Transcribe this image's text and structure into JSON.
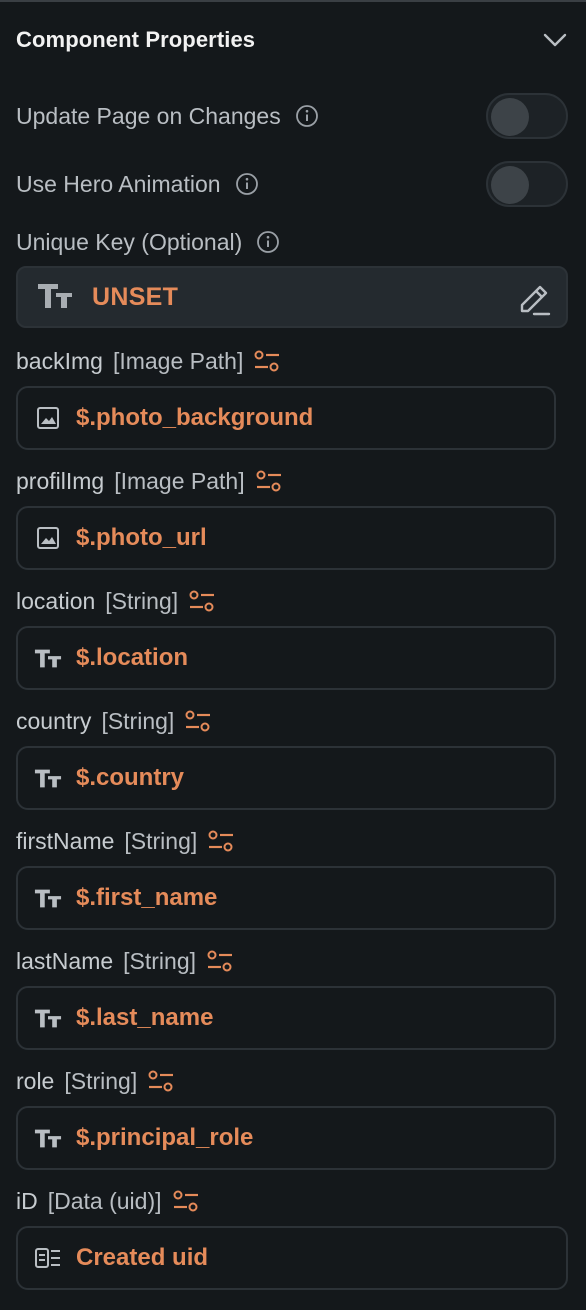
{
  "section_title": "Component Properties",
  "toggles": [
    {
      "label": "Update Page on Changes",
      "on": false
    },
    {
      "label": "Use Hero Animation",
      "on": false
    }
  ],
  "unique_key": {
    "label": "Unique Key (Optional)",
    "value": "UNSET"
  },
  "params": [
    {
      "name": "backImg",
      "type": "[Image Path]",
      "value": "$.photo_background",
      "icon": "image-icon"
    },
    {
      "name": "profilImg",
      "type": "[Image Path]",
      "value": "$.photo_url",
      "icon": "image-icon"
    },
    {
      "name": "location",
      "type": "[String]",
      "value": "$.location",
      "icon": "text-type-icon"
    },
    {
      "name": "country",
      "type": "[String]",
      "value": "$.country",
      "icon": "text-type-icon"
    },
    {
      "name": "firstName",
      "type": "[String]",
      "value": "$.first_name",
      "icon": "text-type-icon"
    },
    {
      "name": "lastName",
      "type": "[String]",
      "value": "$.last_name",
      "icon": "text-type-icon"
    },
    {
      "name": "role",
      "type": "[String]",
      "value": "$.principal_role",
      "icon": "text-type-icon"
    },
    {
      "name": "iD",
      "type": "[Data (uid)]",
      "value": "Created uid",
      "icon": "data-uid-icon"
    }
  ],
  "colors": {
    "accent": "#e58b5a",
    "background": "#14181b",
    "border": "#2c3237"
  }
}
